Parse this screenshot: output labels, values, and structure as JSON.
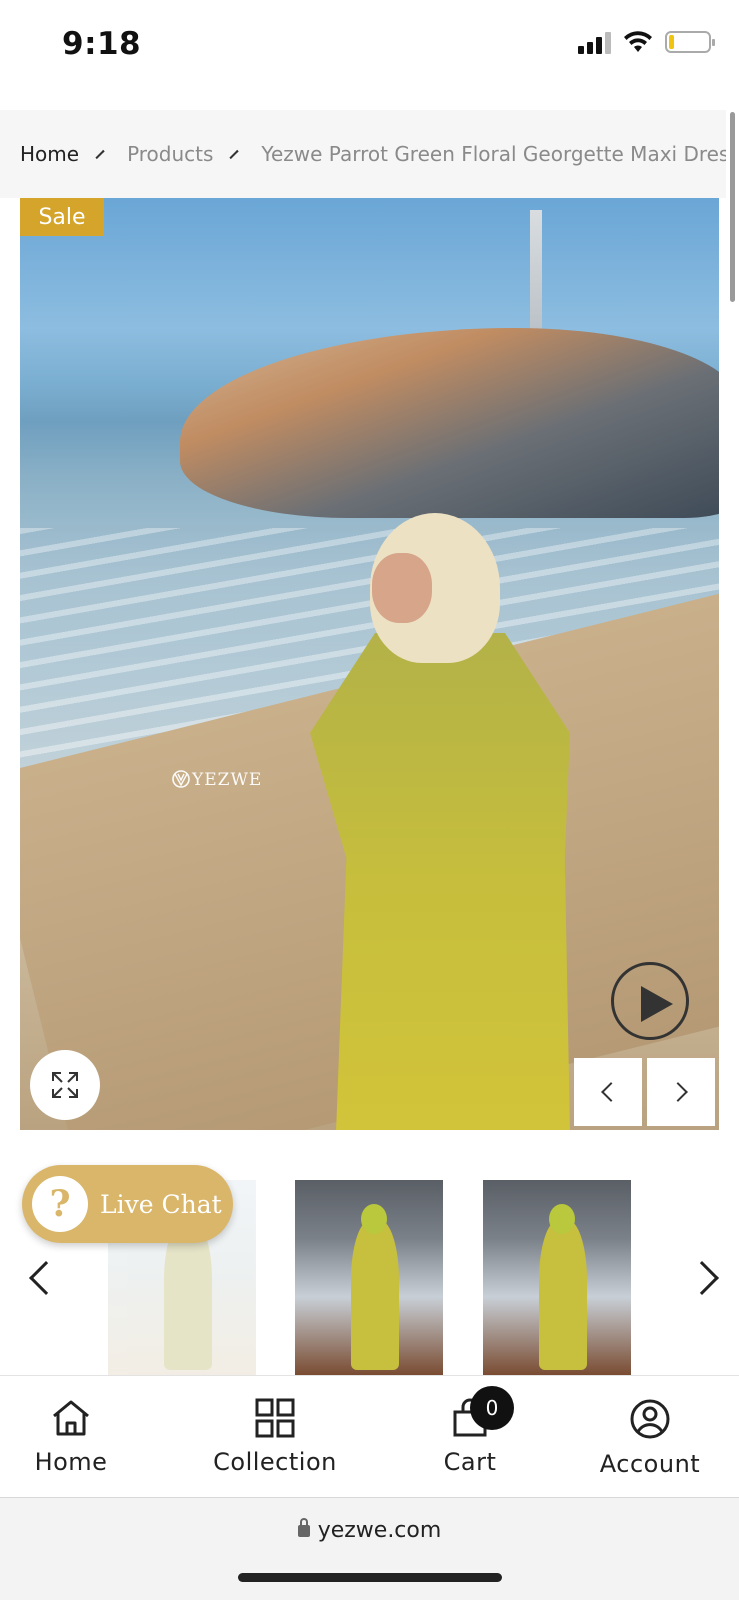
{
  "status_bar": {
    "time": "9:18"
  },
  "breadcrumb": {
    "items": [
      "Home",
      "Products",
      "Yezwe Parrot Green Floral Georgette Maxi Dress"
    ]
  },
  "product": {
    "sale_badge": "Sale",
    "watermark": "YEZWE",
    "thumbnail_count_visible": 3
  },
  "live_chat": {
    "icon_glyph": "?",
    "label": "Live Chat"
  },
  "bottom_nav": {
    "items": [
      {
        "label": "Home",
        "icon": "home-icon"
      },
      {
        "label": "Collection",
        "icon": "grid-icon"
      },
      {
        "label": "Cart",
        "icon": "bag-icon"
      },
      {
        "label": "Account",
        "icon": "user-circle-icon"
      }
    ],
    "cart_count": "0"
  },
  "url_bar": {
    "url": "yezwe.com"
  },
  "colors": {
    "sale_badge": "#d4a52a",
    "live_chat": "#d9b66a",
    "breadcrumb_bg": "#f6f6f6"
  }
}
